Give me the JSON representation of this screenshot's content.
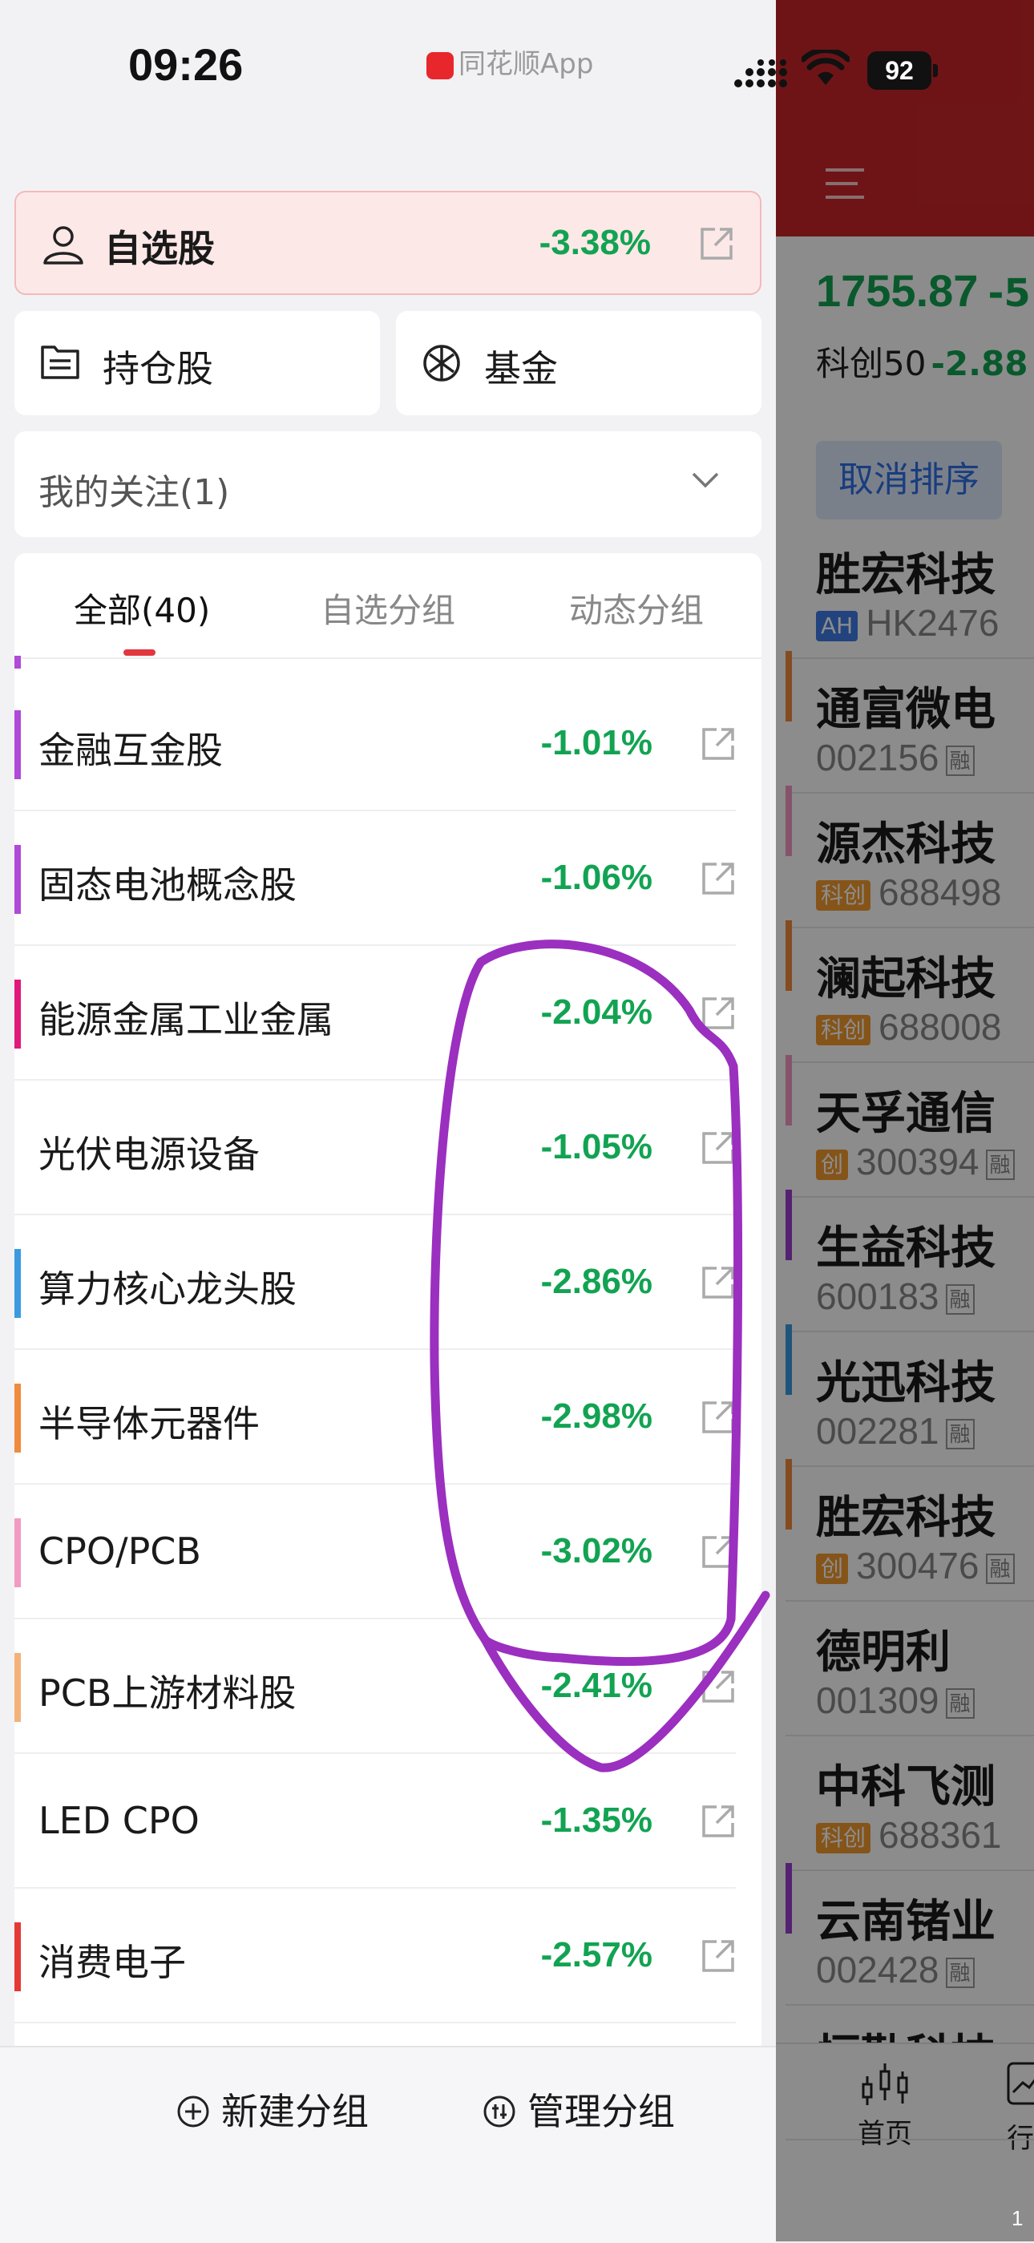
{
  "status_bar": {
    "time": "09:26",
    "app_name": "同花顺App",
    "battery": "92"
  },
  "watchlist": {
    "label": "自选股",
    "change": "-3.38%"
  },
  "holdings": {
    "label": "持仓股"
  },
  "fund": {
    "label": "基金"
  },
  "follow": {
    "label": "我的关注(1)"
  },
  "tabs": {
    "all": "全部(40)",
    "custom": "自选分组",
    "dynamic": "动态分组"
  },
  "groups": [
    {
      "name": "金融互金股",
      "change": "-1.01%",
      "color": "#b04ad8"
    },
    {
      "name": "固态电池概念股",
      "change": "-1.06%",
      "color": "#b04ad8"
    },
    {
      "name": "能源金属工业金属",
      "change": "-2.04%",
      "color": "#e0197a"
    },
    {
      "name": "光伏电源设备",
      "change": "-1.05%",
      "color": ""
    },
    {
      "name": "算力核心龙头股",
      "change": "-2.86%",
      "color": "#3a9be0"
    },
    {
      "name": "半导体元器件",
      "change": "-2.98%",
      "color": "#f08a3c"
    },
    {
      "name": "CPO/PCB",
      "change": "-3.02%",
      "color": "#f29ac4"
    },
    {
      "name": "PCB上游材料股",
      "change": "-2.41%",
      "color": "#f3b27a"
    },
    {
      "name": "LED CPO",
      "change": "-1.35%",
      "color": ""
    },
    {
      "name": "消费电子",
      "change": "-2.57%",
      "color": "#e53935"
    }
  ],
  "bottom": {
    "new_group": "新建分组",
    "manage_group": "管理分组"
  },
  "background": {
    "index_value": "1755.87",
    "index_change": "-5",
    "index_name": "科创50",
    "index_name_change": "-2.88",
    "sort_button": "取消排序",
    "stocks": [
      {
        "name": "胜宏科技",
        "tag": "AH",
        "tag_type": "ah",
        "code": "HK2476",
        "rong": ""
      },
      {
        "name": "通富微电",
        "tag": "",
        "tag_type": "",
        "code": "002156",
        "rong": "融"
      },
      {
        "name": "源杰科技",
        "tag": "科创",
        "tag_type": "kc",
        "code": "688498",
        "rong": ""
      },
      {
        "name": "澜起科技",
        "tag": "科创",
        "tag_type": "kc",
        "code": "688008",
        "rong": ""
      },
      {
        "name": "天孚通信",
        "tag": "创",
        "tag_type": "cy",
        "code": "300394",
        "rong": "融"
      },
      {
        "name": "生益科技",
        "tag": "",
        "tag_type": "",
        "code": "600183",
        "rong": "融"
      },
      {
        "name": "光迅科技",
        "tag": "",
        "tag_type": "",
        "code": "002281",
        "rong": "融"
      },
      {
        "name": "胜宏科技",
        "tag": "创",
        "tag_type": "cy",
        "code": "300476",
        "rong": "融"
      },
      {
        "name": "德明利",
        "tag": "",
        "tag_type": "",
        "code": "001309",
        "rong": "融"
      },
      {
        "name": "中科飞测",
        "tag": "科创",
        "tag_type": "kc",
        "code": "688361",
        "rong": ""
      },
      {
        "name": "云南锗业",
        "tag": "",
        "tag_type": "",
        "code": "002428",
        "rong": "融"
      },
      {
        "name": "恒勤科技",
        "tag": "",
        "tag_type": "",
        "code": "",
        "rong": ""
      }
    ],
    "tab_home": "首页",
    "tab_market": "行"
  },
  "page_number": "1",
  "colors": {
    "down_green": "#12a352",
    "accent_red": "#e0383e",
    "annotation_purple": "#9b2fbf"
  }
}
